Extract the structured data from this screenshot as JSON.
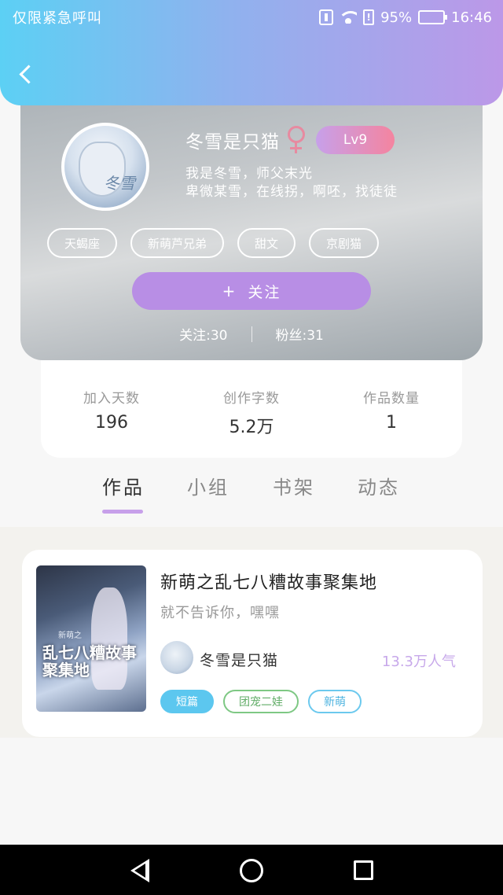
{
  "status_bar": {
    "carrier_text": "仅限紧急呼叫",
    "battery": "95%",
    "time": "16:46"
  },
  "profile": {
    "name": "冬雪是只猫",
    "level": "Lv9",
    "avatar_signature": "冬雪",
    "bio_line1": "我是冬雪，师父末光",
    "bio_line2": "卑微某雪，在线拐，啊呸，找徒徒",
    "tags": [
      "天蝎座",
      "新萌芦兄弟",
      "甜文",
      "京剧猫"
    ],
    "follow_button": "关注",
    "following": "关注:30",
    "followers": "粉丝:31"
  },
  "stats": [
    {
      "label": "加入天数",
      "value": "196"
    },
    {
      "label": "创作字数",
      "value": "5.2万"
    },
    {
      "label": "作品数量",
      "value": "1"
    }
  ],
  "tabs": [
    "作品",
    "小组",
    "书架",
    "动态"
  ],
  "work": {
    "cover_text": "乱七八糟故事聚集地",
    "cover_subtext": "新萌之",
    "title": "新萌之乱七八糟故事聚集地",
    "description": "就不告诉你，嘿嘿",
    "author": "冬雪是只猫",
    "popularity": "13.3万人气",
    "tags": [
      "短篇",
      "团宠二娃",
      "新萌"
    ]
  },
  "colors": {
    "header_start": "#5cd0f4",
    "header_end": "#bc98e8",
    "accent_purple": "#b88ee5",
    "level_pink": "#f4849f",
    "tab_underline": "#c7a0ea"
  }
}
